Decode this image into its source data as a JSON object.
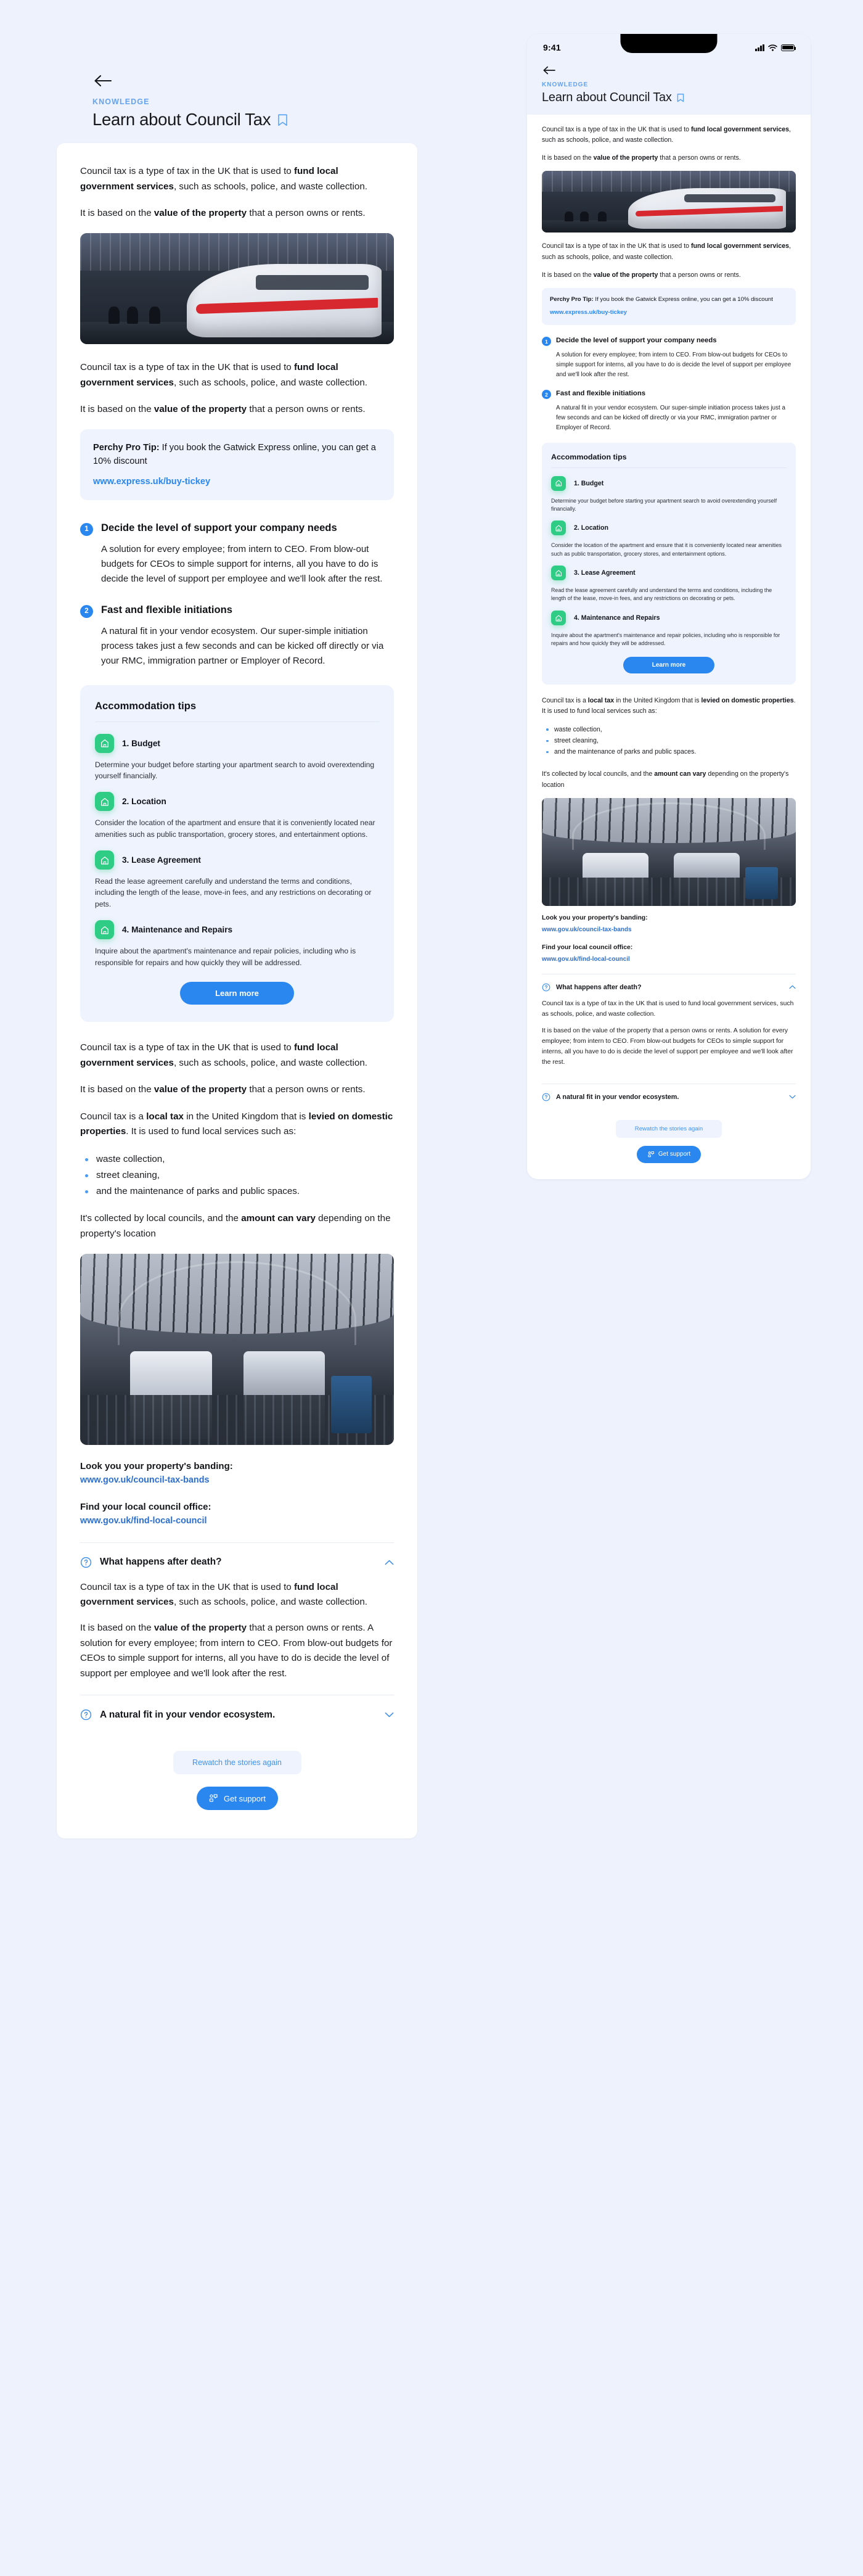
{
  "header": {
    "kicker": "KNOWLEDGE",
    "title": "Learn about Council Tax",
    "back_icon": "back-arrow-icon",
    "bookmark_icon": "bookmark-icon"
  },
  "status_bar": {
    "time": "9:41",
    "signal_icon": "cellular-signal-icon",
    "wifi_icon": "wifi-icon",
    "battery_icon": "battery-icon"
  },
  "intro": {
    "p1_a": "Council tax is a type of tax in the UK that is used to ",
    "p1_b": "fund local government services",
    "p1_c": ", such as schools, police, and waste collection.",
    "p2_a": "It is based on the ",
    "p2_b": "value of the property",
    "p2_c": " that a person owns or rents."
  },
  "images": {
    "train": "train-at-platform-photo",
    "station": "station-concourse-photo"
  },
  "protip": {
    "label": "Perchy Pro Tip:",
    "text": " If you book the Gatwick Express online, you can get a 10% discount",
    "link": "www.express.uk/buy-tickey"
  },
  "steps": [
    {
      "num": "1",
      "title": "Decide the level of support your company needs",
      "text": "A solution for every employee; from intern to CEO. From blow-out budgets for CEOs to simple support for interns, all you have to do is decide the level of support per employee and we'll look after the rest."
    },
    {
      "num": "2",
      "title": "Fast and flexible initiations",
      "text": "A natural fit in your vendor ecosystem. Our super-simple initiation process takes just a few seconds and can be kicked off directly or via your RMC, immigration partner or Employer of Record."
    }
  ],
  "tips": {
    "title": "Accommodation tips",
    "icon": "home-icon",
    "items": [
      {
        "name": "1. Budget",
        "text": "Determine your budget before starting your apartment search to avoid overextending yourself financially."
      },
      {
        "name": "2. Location",
        "text": "Consider the location of the apartment and ensure that it is conveniently located near amenities such as public transportation, grocery stores, and entertainment options."
      },
      {
        "name": "3. Lease Agreement",
        "text": "Read the lease agreement carefully and understand the terms and conditions, including the length of the lease, move-in fees, and any restrictions on decorating or pets."
      },
      {
        "name": "4. Maintenance and Repairs",
        "text": "Inquire about the apartment's maintenance and repair policies, including who is responsible for repairs and how quickly they will be addressed."
      }
    ],
    "cta": "Learn more"
  },
  "local_tax": {
    "p_a": "Council tax is a ",
    "p_b": "local tax",
    "p_c": " in the United Kingdom that is ",
    "p_d": "levied on domestic properties",
    "p_e": ". It is used to fund local services such as:",
    "bullets": [
      "waste collection,",
      "street cleaning,",
      "and the maintenance of parks and public spaces."
    ],
    "closing_a": "It's collected by local councils, and the ",
    "closing_b": "amount can vary",
    "closing_c": " depending on the property's location"
  },
  "links": [
    {
      "label": "Look you your property's banding:",
      "url": "www.gov.uk/council-tax-bands"
    },
    {
      "label": "Find your local council office:",
      "url": "www.gov.uk/find-local-council"
    }
  ],
  "accordions": [
    {
      "icon": "question-circle-icon",
      "title": "What happens after death?",
      "state": "expanded",
      "chevron": "chevron-up-icon",
      "body_p1_a": "Council tax is a type of tax in the UK that is used to ",
      "body_p1_b": "fund local government services",
      "body_p1_c": ", such as schools, police, and waste collection.",
      "body_p2_a": "It is based on the ",
      "body_p2_b": "value of the property",
      "body_p2_c": " that a person owns or rents. A solution for every employee; from intern to CEO. From blow-out budgets for CEOs to simple support for interns, all you have to do is decide the level of support per employee and we'll look after the rest."
    },
    {
      "icon": "question-circle-icon",
      "title": "A natural fit in your vendor ecosystem.",
      "state": "collapsed",
      "chevron": "chevron-down-icon"
    }
  ],
  "footer": {
    "rewatch_label": "Rewatch the stories again",
    "support_label": "Get support",
    "support_icon": "support-chat-icon"
  },
  "colors": {
    "accent_blue": "#2a87f0",
    "link_blue": "#2b6fcf",
    "kicker_blue": "#64a3f0",
    "tip_green": "#2ecc84",
    "page_bg": "#eef2fc",
    "soft_blue": "#eef3fd"
  }
}
